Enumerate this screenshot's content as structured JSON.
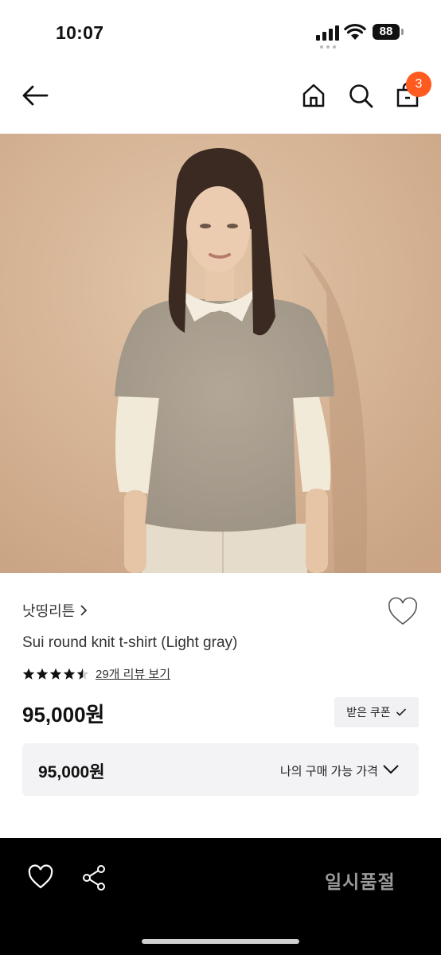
{
  "status_bar": {
    "time": "10:07",
    "battery": "88"
  },
  "nav": {
    "cart_count": "3"
  },
  "product": {
    "brand": "낫띵리튼",
    "title": "Sui round knit t-shirt (Light gray)",
    "rating": 4.5,
    "review_link": "29개 리뷰 보기",
    "price": "95,000원",
    "coupon_button": "받은 쿠폰",
    "my_price": "95,000원",
    "my_price_label": "나의 구매 가능 가격"
  },
  "bottom_bar": {
    "status_label": "일시품절"
  },
  "colors": {
    "badge": "#ff5a1f",
    "hero_bg": "#d8b79a",
    "bottom_bar": "#000000"
  }
}
